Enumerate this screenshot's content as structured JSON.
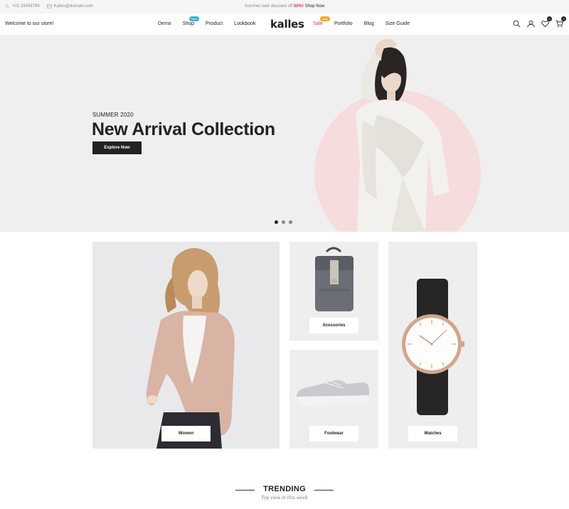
{
  "topbar": {
    "phone": "+01 23456789",
    "email": "Kalles@domain.com",
    "promo_text": "Summer sale discount off",
    "promo_pct": "50%!",
    "promo_link": "Shop Now"
  },
  "header": {
    "welcome": "Welcome to our store!",
    "logo": "kalles",
    "nav_left": [
      {
        "label": "Demo"
      },
      {
        "label": "Shop",
        "badge": "New"
      },
      {
        "label": "Product"
      },
      {
        "label": "Lookbook"
      }
    ],
    "nav_right": [
      {
        "label": "Sale",
        "badge": "Sale"
      },
      {
        "label": "Portfolio"
      },
      {
        "label": "Blog"
      },
      {
        "label": "Size Guide"
      }
    ],
    "wishlist_count": "0",
    "cart_count": "0",
    "icons": [
      "search-icon",
      "user-icon",
      "heart-icon",
      "cart-icon"
    ]
  },
  "hero": {
    "eyebrow": "SUMMER 2020",
    "headline": "New Arrival Collection",
    "cta": "Explore Now",
    "slides_total": 3,
    "active_slide": 1
  },
  "categories": {
    "women": "Women",
    "accessories": "Acessories",
    "footwear": "Footwear",
    "watches": "Watches"
  },
  "trending": {
    "title": "TRENDING",
    "subtitle": "Top view in this week"
  },
  "colors": {
    "accent_red": "#e03a3a",
    "badge_new": "#36b4c7",
    "badge_sale": "#f4a72a",
    "hero_bg": "#efefef",
    "hero_circle": "#f6dcdc",
    "dark": "#222222"
  }
}
